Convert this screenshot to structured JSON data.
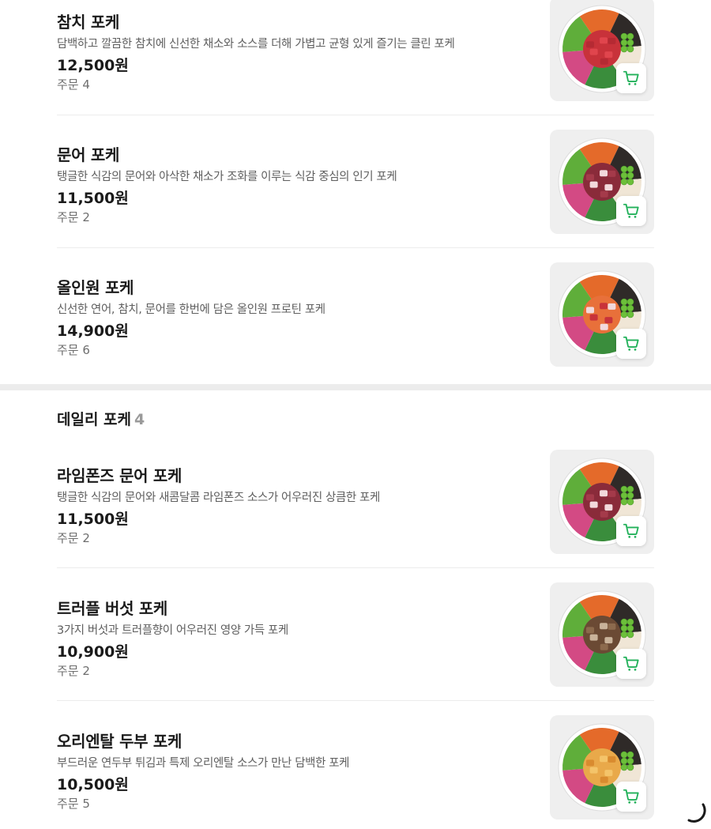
{
  "sections": [
    {
      "title": "",
      "count": "",
      "items": [
        {
          "name": "참치 포케",
          "desc": "담백하고 깔끔한 참치에 신선한 채소와 소스를 더해 가볍고 균형 있게 즐기는 클린 포케",
          "price": "12,500원",
          "orders": "주문 4",
          "topping": "tuna"
        },
        {
          "name": "문어 포케",
          "desc": "탱글한 식감의 문어와 아삭한 채소가 조화를 이루는 식감 중심의 인기 포케",
          "price": "11,500원",
          "orders": "주문 2",
          "topping": "octopus"
        },
        {
          "name": "올인원 포케",
          "desc": "신선한 연어, 참치, 문어를 한번에 담은 올인원 프로틴 포케",
          "price": "14,900원",
          "orders": "주문 6",
          "topping": "mixed"
        }
      ]
    },
    {
      "title": "데일리 포케",
      "count": "4",
      "items": [
        {
          "name": "라임폰즈 문어 포케",
          "desc": "탱글한 식감의 문어와 새콤달콤 라임폰즈 소스가 어우러진 상큼한 포케",
          "price": "11,500원",
          "orders": "주문 2",
          "topping": "octopus"
        },
        {
          "name": "트러플 버섯 포케",
          "desc": "3가지 버섯과 트러플향이 어우러진 영양 가득 포케",
          "price": "10,900원",
          "orders": "주문 2",
          "topping": "mushroom"
        },
        {
          "name": "오리엔탈 두부 포케",
          "desc": "부드러운 연두부 튀김과 특제 오리엔탈 소스가 만난 담백한 포케",
          "price": "10,500원",
          "orders": "주문 5",
          "topping": "tofu"
        }
      ]
    }
  ],
  "icons": {
    "cart": "cart-icon",
    "spinner": "loading-spinner-icon"
  },
  "colors": {
    "accent": "#22b15a",
    "divider": "#ececec",
    "section_gap": "#ececec",
    "thumb_bg": "#efefef"
  }
}
